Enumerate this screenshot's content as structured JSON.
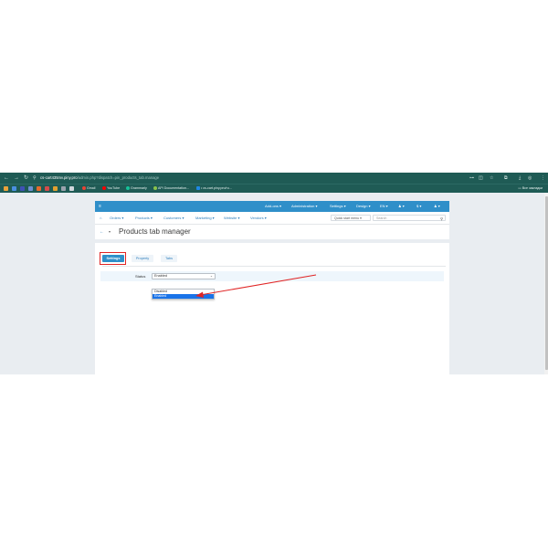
{
  "browser": {
    "url_host": "cs-cart435mv.piny.pro",
    "url_path": "/admin.php?dispatch=pin_products_tab.manage",
    "bookmarks": [
      {
        "label": "Gmail",
        "color": "#ea4335"
      },
      {
        "label": "YouTube",
        "color": "#ff0000"
      },
      {
        "label": "Grammarly",
        "color": "#15c39a"
      },
      {
        "label": "API Documentation...",
        "color": "#8bc34a"
      },
      {
        "label": "• cs-cart.piny.pro/ru...",
        "color": "#1e88e5"
      }
    ],
    "all_bookmarks": "Все закладки"
  },
  "topbar": {
    "items": [
      "Add-ons ▾",
      "Administration ▾",
      "Settings ▾",
      "Design ▾",
      "EN ▾",
      "♟ ▾",
      "$ ▾",
      "♟ ▾"
    ]
  },
  "menubar": {
    "items": [
      "Orders ▾",
      "Products ▾",
      "Customers ▾",
      "Marketing ▾",
      "Website ▾",
      "Vendors ▾"
    ],
    "quick_start": "Quick start menu ▾",
    "search_placeholder": "Search"
  },
  "page": {
    "title": "Products tab manager"
  },
  "tabs": [
    "Settings",
    "Property",
    "Tabs"
  ],
  "form": {
    "status_label": "Status",
    "status_value": "Enabled",
    "options": [
      "Disabled",
      "Enabled"
    ]
  },
  "colors": {
    "chrome": "#1f5b55",
    "topbar": "#2f8fc9",
    "accent": "#2f7fbd",
    "highlight": "#e02424",
    "selected_option": "#1a73e8"
  }
}
